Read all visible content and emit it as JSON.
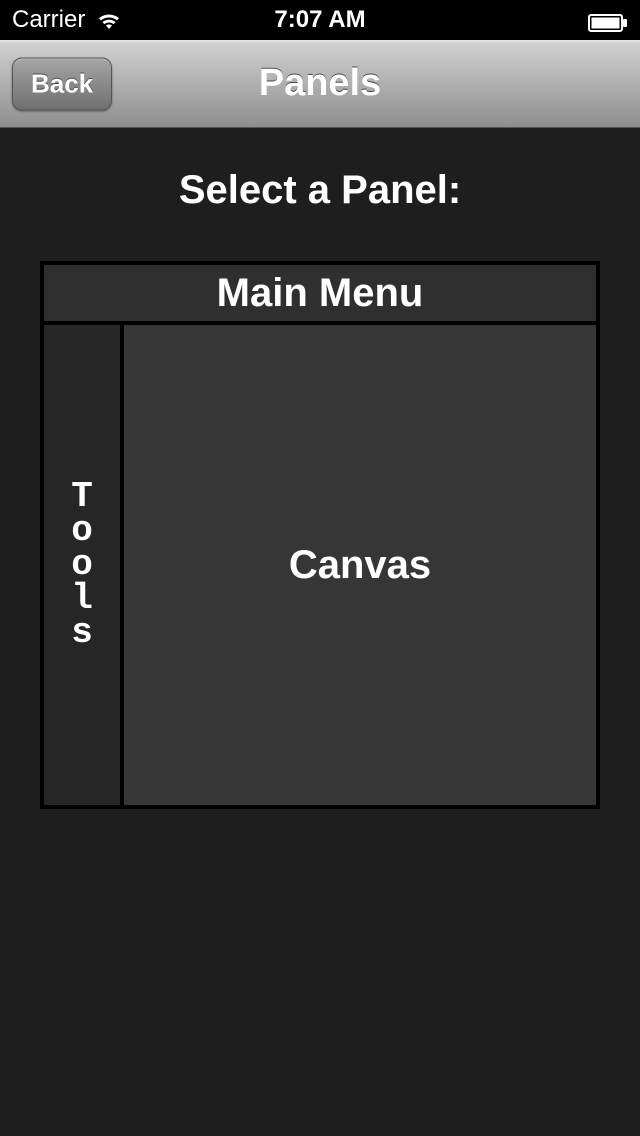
{
  "status_bar": {
    "carrier": "Carrier",
    "time": "7:07 AM"
  },
  "nav": {
    "back_label": "Back",
    "title": "Panels"
  },
  "content": {
    "prompt": "Select a Panel:",
    "panels": {
      "main_menu": "Main Menu",
      "tools": "Tools",
      "canvas": "Canvas"
    }
  }
}
